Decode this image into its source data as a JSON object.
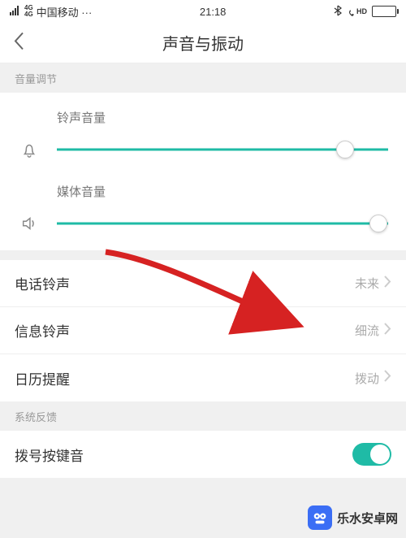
{
  "statusbar": {
    "net_label": "4G",
    "carrier": "中国移动 ···",
    "time": "21:18",
    "hd": "HD"
  },
  "header": {
    "title": "声音与振动"
  },
  "sections": {
    "volume_header": "音量调节",
    "feedback_header": "系统反馈"
  },
  "sliders": {
    "ringtone": {
      "label": "铃声音量",
      "percent": 87
    },
    "media": {
      "label": "媒体音量",
      "percent": 97
    }
  },
  "items": {
    "phone_ringtone": {
      "label": "电话铃声",
      "value": "未来"
    },
    "message_ringtone": {
      "label": "信息铃声",
      "value": "细流"
    },
    "calendar_reminder": {
      "label": "日历提醒",
      "value": "拨动"
    },
    "dialpad_sound": {
      "label": "拨号按键音",
      "enabled": true
    }
  },
  "watermark": {
    "text": "乐水安卓网"
  }
}
